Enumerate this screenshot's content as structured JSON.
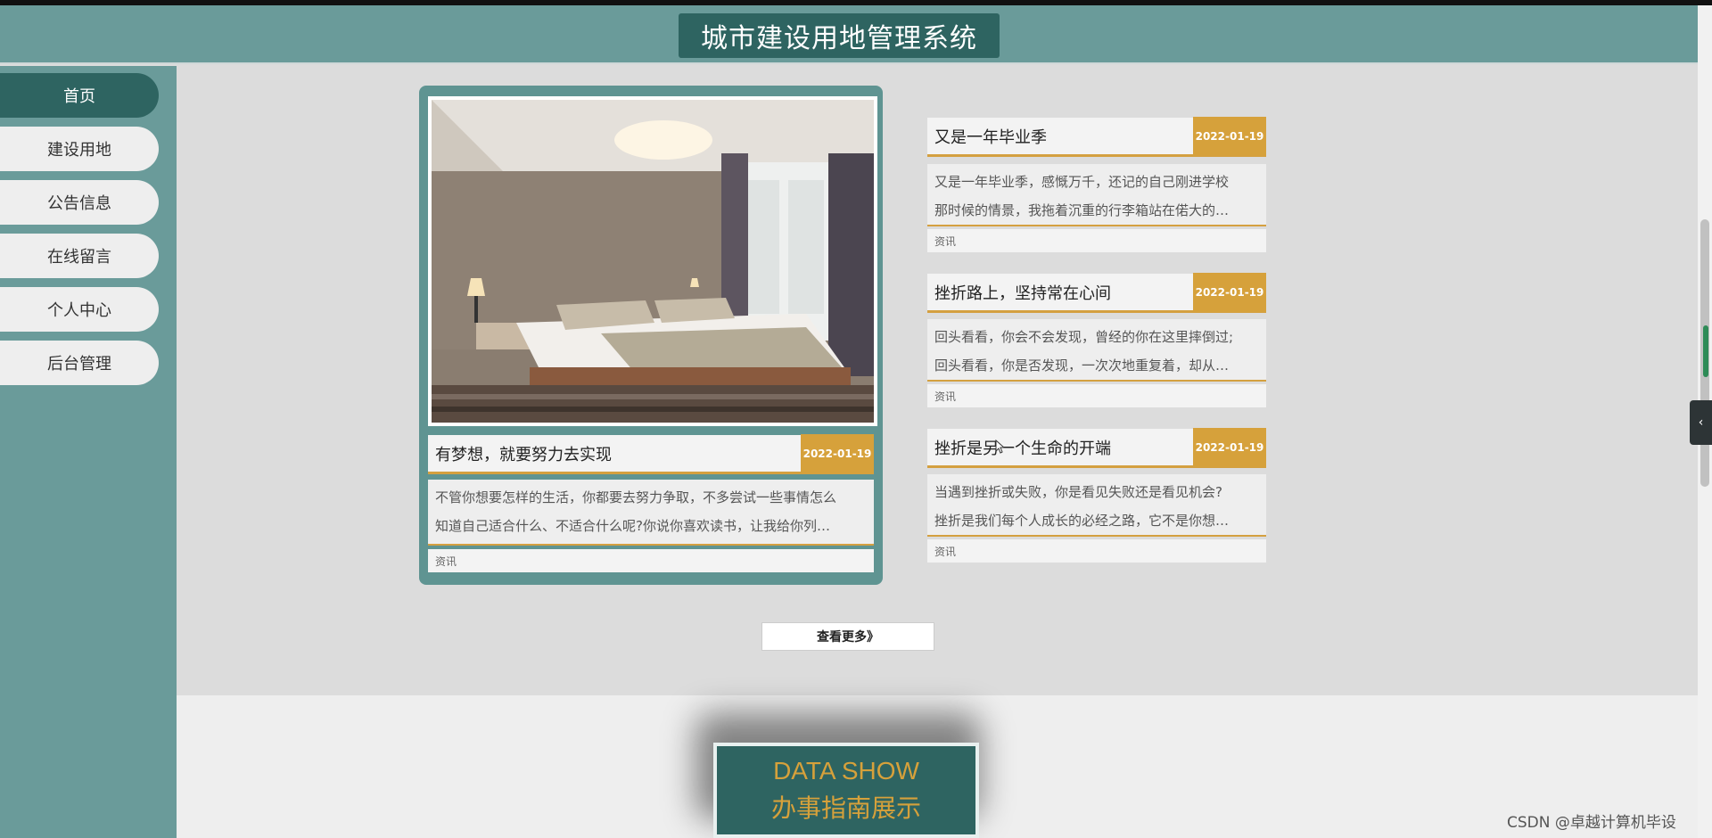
{
  "header": {
    "title": "城市建设用地管理系统"
  },
  "sidebar": {
    "items": [
      {
        "label": "首页",
        "active": true
      },
      {
        "label": "建设用地",
        "active": false
      },
      {
        "label": "公告信息",
        "active": false
      },
      {
        "label": "在线留言",
        "active": false
      },
      {
        "label": "个人中心",
        "active": false
      },
      {
        "label": "后台管理",
        "active": false
      }
    ]
  },
  "featured": {
    "title": "有梦想，就要努力去实现",
    "date": "2022-01-19",
    "line1": "不管你想要怎样的生活，你都要去努力争取，不多尝试一些事情怎么",
    "line2": "知道自己适合什么、不适合什么呢?你说你喜欢读书，让我给你列…",
    "tag": "资讯"
  },
  "news": [
    {
      "title": "又是一年毕业季",
      "date": "2022-01-19",
      "line1": "又是一年毕业季，感慨万千，还记的自己刚进学校",
      "line2": "那时候的情景，我拖着沉重的行李箱站在偌大的…",
      "tag": "资讯"
    },
    {
      "title": "挫折路上，坚持常在心间",
      "date": "2022-01-19",
      "line1": "回头看看，你会不会发现，曾经的你在这里摔倒过;",
      "line2": "回头看看，你是否发现，一次次地重复着，却从…",
      "tag": "资讯"
    },
    {
      "title": "挫折是另一个生命的开端",
      "date": "2022-01-19",
      "line1": "当遇到挫折或失败，你是看见失败还是看见机会?",
      "line2": "挫折是我们每个人成长的必经之路，它不是你想…",
      "tag": "资讯"
    }
  ],
  "more_button": "查看更多》",
  "data_show": {
    "en": "DATA SHOW",
    "cn": "办事指南展示"
  },
  "watermark": "CSDN @卓越计算机毕设",
  "colors": {
    "primary": "#2e6461",
    "secondary": "#6a9b9a",
    "accent": "#d6a13b"
  }
}
